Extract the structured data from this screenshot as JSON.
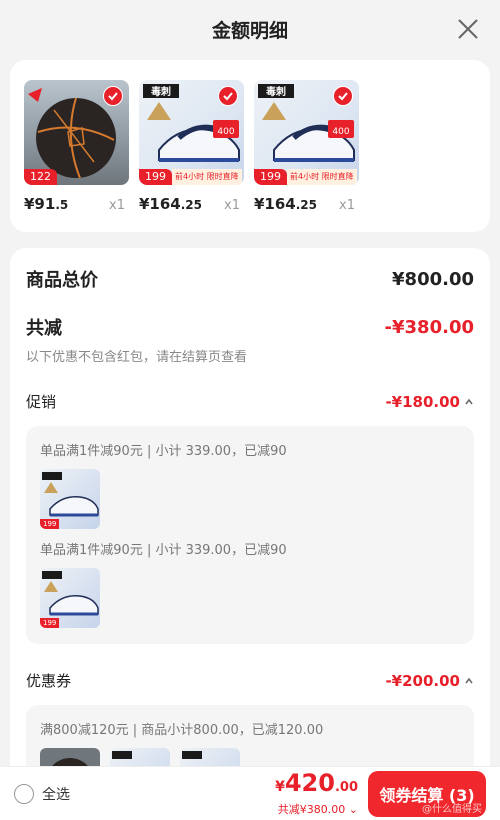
{
  "header": {
    "title": "金额明细"
  },
  "products": [
    {
      "price_int": "¥91",
      "price_dec": ".5",
      "qty": "x1",
      "tag": "122",
      "tag_text": "",
      "kind": "ball"
    },
    {
      "price_int": "¥164",
      "price_dec": ".25",
      "qty": "x1",
      "tag": "199",
      "tag_text": "前4小时 限时直降",
      "kind": "shoe"
    },
    {
      "price_int": "¥164",
      "price_dec": ".25",
      "qty": "x1",
      "tag": "199",
      "tag_text": "前4小时 限时直降",
      "kind": "shoe"
    }
  ],
  "summary": {
    "total_label": "商品总价",
    "total_value": "¥800.00",
    "discount_label": "共减",
    "discount_value": "-¥380.00",
    "note": "以下优惠不包含红包，请在结算页查看"
  },
  "promo": {
    "label": "促销",
    "value": "-¥180.00",
    "rules": [
      {
        "text": "单品满1件减90元 | 小计 339.00，已减90",
        "tag": "199"
      },
      {
        "text": "单品满1件减90元 | 小计 339.00，已减90",
        "tag": "199"
      }
    ]
  },
  "coupon": {
    "label": "优惠券",
    "value": "-¥200.00",
    "rule": "满800减120元 | 商品小计800.00，已减120.00"
  },
  "footer": {
    "select_all": "全选",
    "currency": "¥",
    "total_int": "420",
    "total_dec": ".00",
    "saved": "共减¥380.00",
    "checkout": "领券结算 (3)",
    "watermark": "@什么值得买"
  },
  "colors": {
    "accent": "#e8202a"
  }
}
